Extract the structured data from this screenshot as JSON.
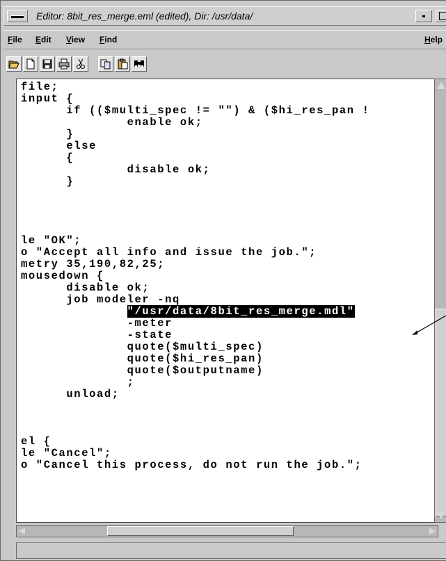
{
  "window": {
    "title": "Editor: 8bit_res_merge.eml (edited), Dir: /usr/data/"
  },
  "menu": {
    "items": [
      {
        "label": "File"
      },
      {
        "label": "Edit"
      },
      {
        "label": "View"
      },
      {
        "label": "Find"
      }
    ],
    "help": "Help"
  },
  "toolbar": {
    "buttons": [
      {
        "icon": "open-folder-icon"
      },
      {
        "icon": "new-document-icon"
      },
      {
        "icon": "save-disk-icon"
      },
      {
        "icon": "print-icon"
      },
      {
        "icon": "cut-scissors-icon"
      },
      {
        "icon": "copy-icon"
      },
      {
        "icon": "paste-icon"
      },
      {
        "icon": "find-binoculars-icon"
      }
    ]
  },
  "editor": {
    "lines": [
      {
        "text": "file;"
      },
      {
        "text": "input {"
      },
      {
        "text": "      if (($multi_spec != \"\") & ($hi_res_pan !"
      },
      {
        "text": "              enable ok;"
      },
      {
        "text": "      }"
      },
      {
        "text": "      else"
      },
      {
        "text": "      {"
      },
      {
        "text": "              disable ok;"
      },
      {
        "text": "      }"
      },
      {
        "text": ""
      },
      {
        "text": ""
      },
      {
        "text": ""
      },
      {
        "text": ""
      },
      {
        "text": "le \"OK\";"
      },
      {
        "text": "o \"Accept all info and issue the job.\";"
      },
      {
        "text": "metry 35,190,82,25;"
      },
      {
        "text": "mousedown {"
      },
      {
        "text": "      disable ok;"
      },
      {
        "text": "      job modeler -nq"
      },
      {
        "pre": "              ",
        "highlight": "\"/usr/data/8bit_res_merge.mdl\""
      },
      {
        "text": "              -meter"
      },
      {
        "text": "              -state"
      },
      {
        "text": "              quote($multi_spec)"
      },
      {
        "text": "              quote($hi_res_pan)"
      },
      {
        "text": "              quote($outputname)"
      },
      {
        "text": "              ;"
      },
      {
        "text": "      unload;"
      },
      {
        "text": ""
      },
      {
        "text": ""
      },
      {
        "text": ""
      },
      {
        "text": "el {"
      },
      {
        "text": "le \"Cancel\";"
      },
      {
        "text": "o \"Cancel this process, do not run the job.\";"
      }
    ]
  },
  "status": {
    "text": ""
  }
}
